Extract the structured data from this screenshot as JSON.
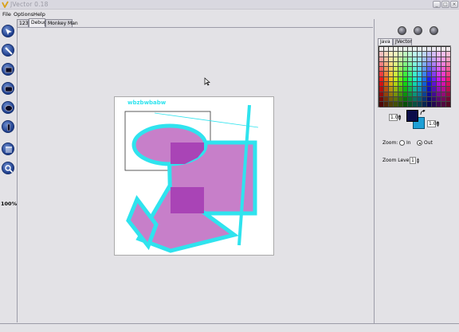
{
  "window": {
    "title": "JVector 0.18"
  },
  "menu": {
    "items": [
      "File",
      "Options",
      "Help"
    ]
  },
  "tabs": [
    "123",
    "Debug",
    "Monkey Man"
  ],
  "active_tab": "Debug",
  "left_toolbar": {
    "tools": [
      "select-tool",
      "line-tool",
      "rectangle-tool",
      "rounded-rectangle-tool",
      "ellipse-tool",
      "text-tool",
      "grid-tool",
      "zoom-tool"
    ],
    "zoom_label": "100%"
  },
  "canvas": {
    "text_shape": "wbzbwbabw"
  },
  "right_panel": {
    "tabs": [
      "Java",
      "JVector"
    ],
    "active_tab": "Java",
    "fg_alpha": "1.00",
    "bg_alpha": "1.00",
    "zoom_label": "Zoom:",
    "zoom_in_label": "In",
    "zoom_out_label": "Out",
    "zoom_selected": "Out",
    "zoom_level_label": "Zoom Level:",
    "zoom_level_value": "1",
    "fg_color": "#0b0d4a",
    "bg_color": "#1ea0d6"
  },
  "colors": {
    "shape_fill": "#c77fc9",
    "shape_stroke": "#2fe3ee",
    "overlap_fill": "#a944b6"
  }
}
